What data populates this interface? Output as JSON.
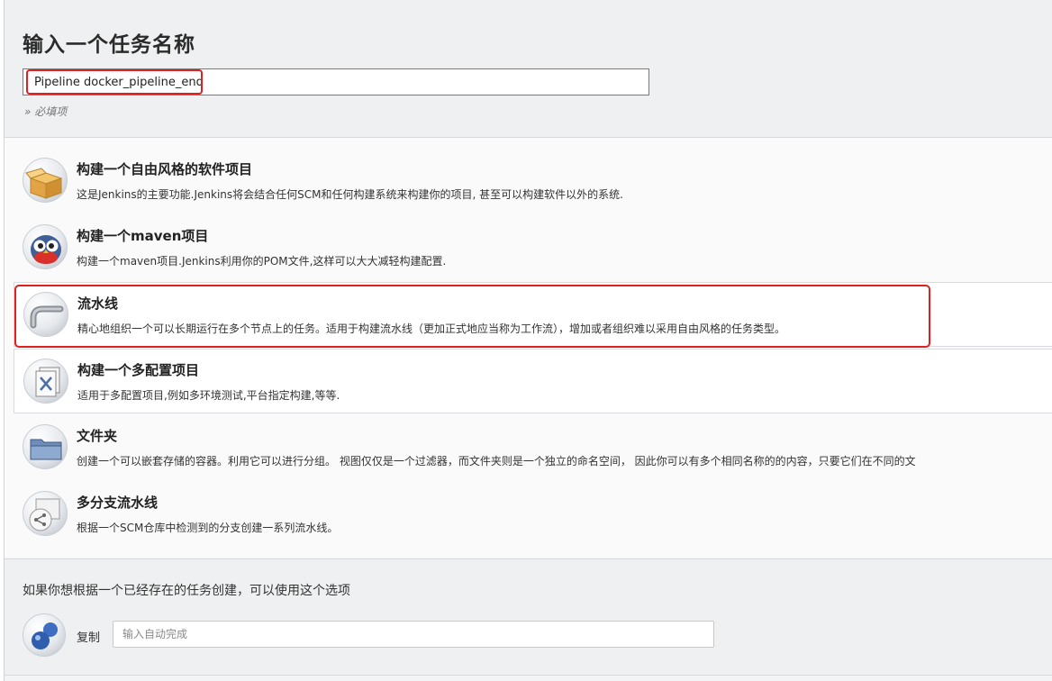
{
  "header": {
    "title": "输入一个任务名称",
    "name_value": "Pipeline docker_pipeline_end",
    "required_hint": "» 必填项"
  },
  "item_types": [
    {
      "name": "构建一个自由风格的软件项目",
      "desc": "这是Jenkins的主要功能.Jenkins将会结合任何SCM和任何构建系统来构建你的项目, 甚至可以构建软件以外的系统.",
      "icon": "freestyle-box-icon"
    },
    {
      "name": "构建一个maven项目",
      "desc": "构建一个maven项目.Jenkins利用你的POM文件,这样可以大大减轻构建配置.",
      "icon": "maven-owl-icon"
    },
    {
      "name": "流水线",
      "desc": "精心地组织一个可以长期运行在多个节点上的任务。适用于构建流水线（更加正式地应当称为工作流），增加或者组织难以采用自由风格的任务类型。",
      "icon": "pipeline-pipe-icon"
    },
    {
      "name": "构建一个多配置项目",
      "desc": "适用于多配置项目,例如多环境测试,平台指定构建,等等.",
      "icon": "multi-config-icon"
    },
    {
      "name": "文件夹",
      "desc": "创建一个可以嵌套存储的容器。利用它可以进行分组。 视图仅仅是一个过滤器，而文件夹则是一个独立的命名空间， 因此你可以有多个相同名称的的内容，只要它们在不同的文",
      "icon": "folder-icon"
    },
    {
      "name": "多分支流水线",
      "desc": "根据一个SCM仓库中检测到的分支创建一系列流水线。",
      "icon": "multibranch-icon"
    }
  ],
  "copy": {
    "hint": "如果你想根据一个已经存在的任务创建，可以使用这个选项",
    "label": "复制",
    "placeholder": "输入自动完成",
    "icon": "copy-spheres-icon"
  },
  "colors": {
    "highlight": "#e0201e",
    "header_bg": "#eef0f2",
    "list_bg": "#fafafa"
  }
}
